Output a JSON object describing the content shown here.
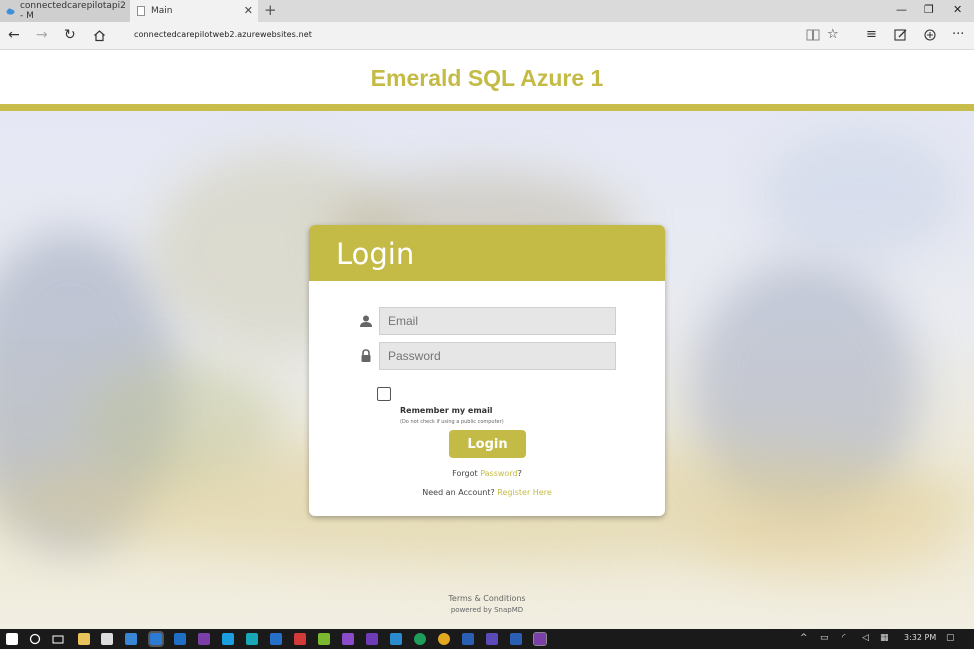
{
  "browser": {
    "tabs": [
      {
        "label": "connectedcarepilotapi2 - M"
      },
      {
        "label": "Main"
      }
    ],
    "url": "connectedcarepilotweb2.azurewebsites.net",
    "accent": "#c4bb47"
  },
  "site": {
    "title": "Emerald SQL Azure 1"
  },
  "login": {
    "heading": "Login",
    "email_placeholder": "Email",
    "password_placeholder": "Password",
    "remember_label": "Remember my email",
    "remember_note": "(Do not check if using a public computer)",
    "submit_label": "Login",
    "forgot_prefix": "Forgot ",
    "forgot_link": "Password",
    "forgot_suffix": "?",
    "register_prefix": "Need an Account? ",
    "register_link": "Register Here"
  },
  "footer": {
    "terms": "Terms & Conditions",
    "powered": "powered by SnapMD"
  },
  "taskbar": {
    "clock": "3:32 PM"
  }
}
